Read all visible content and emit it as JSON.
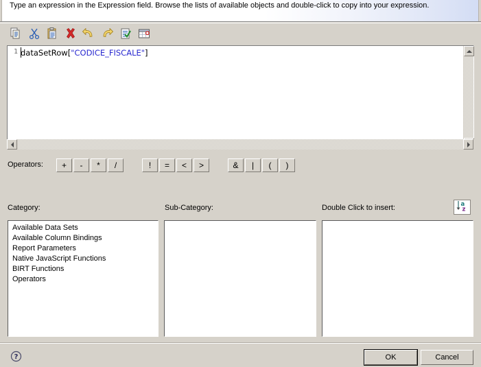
{
  "header": {
    "instruction": "Type an expression in the Expression field. Browse the lists of available objects and double-click to copy into your expression."
  },
  "toolbar": {
    "buttons": [
      {
        "name": "copy-icon",
        "tooltip": "Copy"
      },
      {
        "name": "cut-icon",
        "tooltip": "Cut"
      },
      {
        "name": "paste-icon",
        "tooltip": "Paste"
      },
      {
        "name": "delete-icon",
        "tooltip": "Delete"
      },
      {
        "name": "undo-icon",
        "tooltip": "Undo"
      },
      {
        "name": "redo-icon",
        "tooltip": "Redo"
      },
      {
        "name": "validate-icon",
        "tooltip": "Validate"
      },
      {
        "name": "format-icon",
        "tooltip": "Format"
      }
    ]
  },
  "editor": {
    "line_number": "1",
    "code_prefix": "dataSetRow[",
    "code_string": "\"CODICE_FISCALE\"",
    "code_suffix": "]",
    "full_text": "dataSetRow[\"CODICE_FISCALE\"]",
    "string_color": "#2a2ad0"
  },
  "operators": {
    "label": "Operators:",
    "group1": [
      "+",
      "-",
      "*",
      "/"
    ],
    "group2": [
      "!",
      "=",
      "<",
      ">"
    ],
    "group3": [
      "&",
      "|",
      "(",
      ")"
    ]
  },
  "columns": {
    "category_label": "Category:",
    "subcategory_label": "Sub-Category:",
    "insert_label": "Double Click to insert:",
    "sort_button": "sort-az-icon"
  },
  "lists": {
    "category_items": [
      "Available Data Sets",
      "Available Column Bindings",
      "Report Parameters",
      "Native JavaScript Functions",
      "BIRT Functions",
      "Operators"
    ],
    "subcategory_items": [],
    "insert_items": []
  },
  "footer": {
    "help_icon": "help-icon",
    "ok_label": "OK",
    "cancel_label": "Cancel"
  },
  "colors": {
    "dialog_bg": "#d6d2ca",
    "field_bg": "#ffffff",
    "accent_blue": "#2a2ad0"
  }
}
